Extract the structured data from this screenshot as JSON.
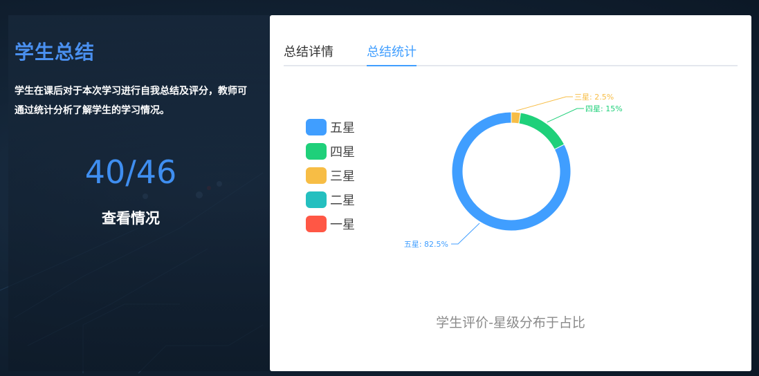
{
  "left": {
    "title": "学生总结",
    "description": "学生在课后对于本次学习进行自我总结及评分，教师可通过统计分析了解学生的学习情况。",
    "count": "40/46",
    "view_link": "查看情况"
  },
  "tabs": [
    {
      "label": "总结详情",
      "active": false
    },
    {
      "label": "总结统计",
      "active": true
    }
  ],
  "colors": {
    "five_star": "#409eff",
    "four_star": "#1fd07a",
    "three_star": "#f7bd45",
    "two_star": "#24bfbf",
    "one_star": "#ff5745"
  },
  "chart_data": {
    "type": "pie",
    "title": "学生评价-星级分布于占比",
    "legend_position": "left",
    "slices": [
      {
        "name": "五星",
        "value": 82.5,
        "label": "五星: 82.5%",
        "color": "#409eff"
      },
      {
        "name": "四星",
        "value": 15,
        "label": "四星: 15%",
        "color": "#1fd07a"
      },
      {
        "name": "三星",
        "value": 2.5,
        "label": "三星: 2.5%",
        "color": "#f7bd45"
      },
      {
        "name": "二星",
        "value": 0,
        "label": "",
        "color": "#24bfbf"
      },
      {
        "name": "一星",
        "value": 0,
        "label": "",
        "color": "#ff5745"
      }
    ],
    "legend": [
      "五星",
      "四星",
      "三星",
      "二星",
      "一星"
    ]
  }
}
